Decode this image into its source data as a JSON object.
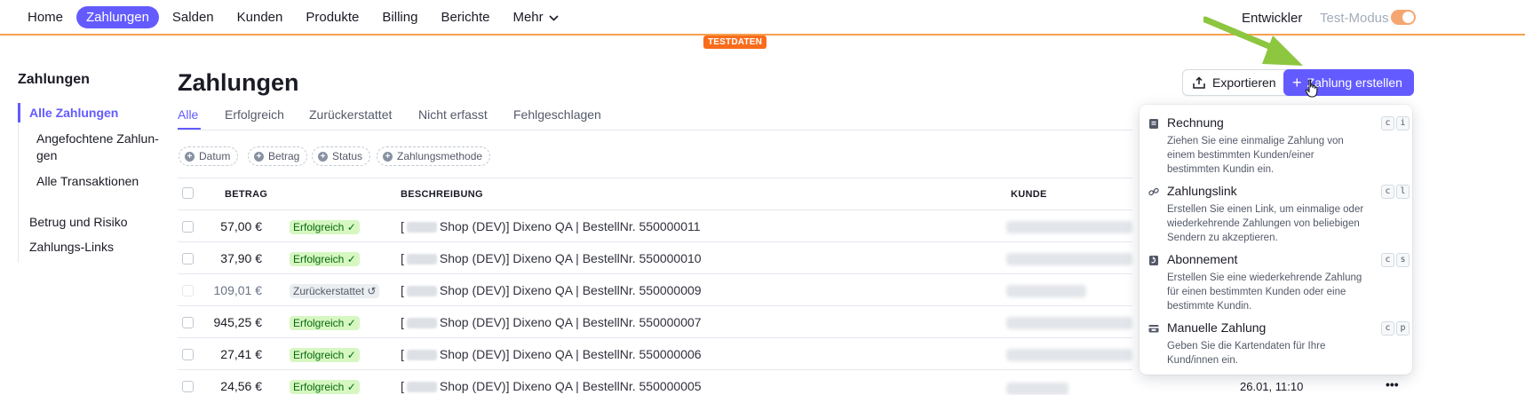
{
  "topnav": {
    "items": [
      {
        "label": "Home",
        "active": false
      },
      {
        "label": "Zahlungen",
        "active": true
      },
      {
        "label": "Salden",
        "active": false
      },
      {
        "label": "Kunden",
        "active": false
      },
      {
        "label": "Produkte",
        "active": false
      },
      {
        "label": "Billing",
        "active": false
      },
      {
        "label": "Berichte",
        "active": false
      },
      {
        "label": "Mehr",
        "active": false
      }
    ],
    "developer_label": "Entwickler",
    "testmode_label": "Test-Modus",
    "testmode_on": true,
    "testdata_badge": "TESTDATEN"
  },
  "sidebar": {
    "title": "Zahlungen",
    "items": [
      {
        "label": "Alle Zahlungen",
        "active": true
      },
      {
        "label": "Angefochtene Zahlun-gen",
        "active": false
      },
      {
        "label": "Alle Transaktionen",
        "active": false
      },
      {
        "label": "Betrug und Risiko",
        "active": false
      },
      {
        "label": "Zahlungs-Links",
        "active": false
      }
    ]
  },
  "page": {
    "title": "Zahlungen",
    "export_label": "Exportieren",
    "create_label": "Zahlung erstellen"
  },
  "tabs": [
    {
      "label": "Alle",
      "active": true
    },
    {
      "label": "Erfolgreich",
      "active": false
    },
    {
      "label": "Zurückerstattet",
      "active": false
    },
    {
      "label": "Nicht erfasst",
      "active": false
    },
    {
      "label": "Fehlgeschlagen",
      "active": false
    }
  ],
  "filters": [
    "Datum",
    "Betrag",
    "Status",
    "Zahlungsmethode"
  ],
  "table": {
    "headers": {
      "amount": "BETRAG",
      "description": "BESCHREIBUNG",
      "customer": "KUNDE"
    },
    "rows": [
      {
        "amount": "57,00 €",
        "status": "Erfolgreich",
        "status_type": "ok",
        "description": "Shop (DEV)] Dixeno QA | BestellNr. 550000011",
        "date": ""
      },
      {
        "amount": "37,90 €",
        "status": "Erfolgreich",
        "status_type": "ok",
        "description": "Shop (DEV)] Dixeno QA | BestellNr. 550000010",
        "date": ""
      },
      {
        "amount": "109,01 €",
        "status": "Zurückerstattet",
        "status_type": "ref",
        "description": "Shop (DEV)] Dixeno QA | BestellNr. 550000009",
        "date": ""
      },
      {
        "amount": "945,25 €",
        "status": "Erfolgreich",
        "status_type": "ok",
        "description": "Shop (DEV)] Dixeno QA | BestellNr. 550000007",
        "date": ""
      },
      {
        "amount": "27,41 €",
        "status": "Erfolgreich",
        "status_type": "ok",
        "description": "Shop (DEV)] Dixeno QA | BestellNr. 550000006",
        "date": ""
      },
      {
        "amount": "24,56 €",
        "status": "Erfolgreich",
        "status_type": "ok",
        "description": "Shop (DEV)] Dixeno QA | BestellNr. 550000005",
        "date": "26.01, 11:10"
      }
    ]
  },
  "create_menu": [
    {
      "icon": "invoice-icon",
      "title": "Rechnung",
      "desc": "Ziehen Sie eine einmalige Zahlung von einem bestimmten Kunden/einer bestimmten Kundin ein.",
      "keys": [
        "c",
        "i"
      ]
    },
    {
      "icon": "link-icon",
      "title": "Zahlungslink",
      "desc": "Erstellen Sie einen Link, um einmalige oder wiederkehrende Zahlungen von beliebigen Sendern zu akzeptieren.",
      "keys": [
        "c",
        "l"
      ]
    },
    {
      "icon": "subscription-icon",
      "title": "Abonnement",
      "desc": "Erstellen Sie eine wiederkehrende Zahlung für einen bestimmten Kunden oder eine bestimmte Kundin.",
      "keys": [
        "c",
        "s"
      ]
    },
    {
      "icon": "card-icon",
      "title": "Manuelle Zahlung",
      "desc": "Geben Sie die Kartendaten für Ihre Kund/innen ein.",
      "keys": [
        "c",
        "p"
      ]
    }
  ],
  "colors": {
    "accent": "#635bff",
    "success_bg": "#d7f7c2",
    "testmode": "#f96c1b"
  }
}
